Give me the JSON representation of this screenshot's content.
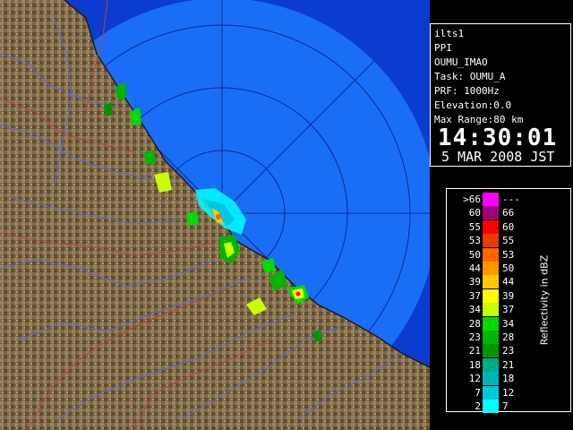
{
  "radar_info": {
    "station": "ilts1",
    "product": "PPI",
    "site": "OUMU_IMAO",
    "task": "Task: OUMU_A",
    "prf": "PRF: 1000Hz",
    "elevation": "Elevation:0.0",
    "max_range": "Max Range:80 km",
    "time": "14:30:01",
    "date": "5 MAR 2008 JST"
  },
  "legend": {
    "unit": "Reflectivity in dBZ",
    "rows": [
      {
        "low": ">66",
        "high": "---",
        "color": "#ff00ff"
      },
      {
        "low": "60",
        "high": "66",
        "color": "#a00078"
      },
      {
        "low": "55",
        "high": "60",
        "color": "#ff0000"
      },
      {
        "low": "53",
        "high": "55",
        "color": "#e83c00"
      },
      {
        "low": "50",
        "high": "53",
        "color": "#ff6400"
      },
      {
        "low": "44",
        "high": "50",
        "color": "#ff9600"
      },
      {
        "low": "39",
        "high": "44",
        "color": "#ffc800"
      },
      {
        "low": "37",
        "high": "39",
        "color": "#ffff00"
      },
      {
        "low": "34",
        "high": "37",
        "color": "#c8ff00"
      },
      {
        "low": "28",
        "high": "34",
        "color": "#00dc00"
      },
      {
        "low": "23",
        "high": "28",
        "color": "#00b400"
      },
      {
        "low": "21",
        "high": "23",
        "color": "#009600"
      },
      {
        "low": "18",
        "high": "21",
        "color": "#00aa88"
      },
      {
        "low": "12",
        "high": "18",
        "color": "#00b4b4"
      },
      {
        "low": "7",
        "high": "12",
        "color": "#00c8dc"
      },
      {
        "low": "2",
        "high": "7",
        "color": "#00ffff"
      }
    ]
  },
  "colors": {
    "sea": "#1a6ef5",
    "sea_outer": "#0a3cd0",
    "land": "#8a7350",
    "river": "#5a6ad8",
    "border": "#b8443a",
    "range_ring": "#0a2a9a"
  }
}
